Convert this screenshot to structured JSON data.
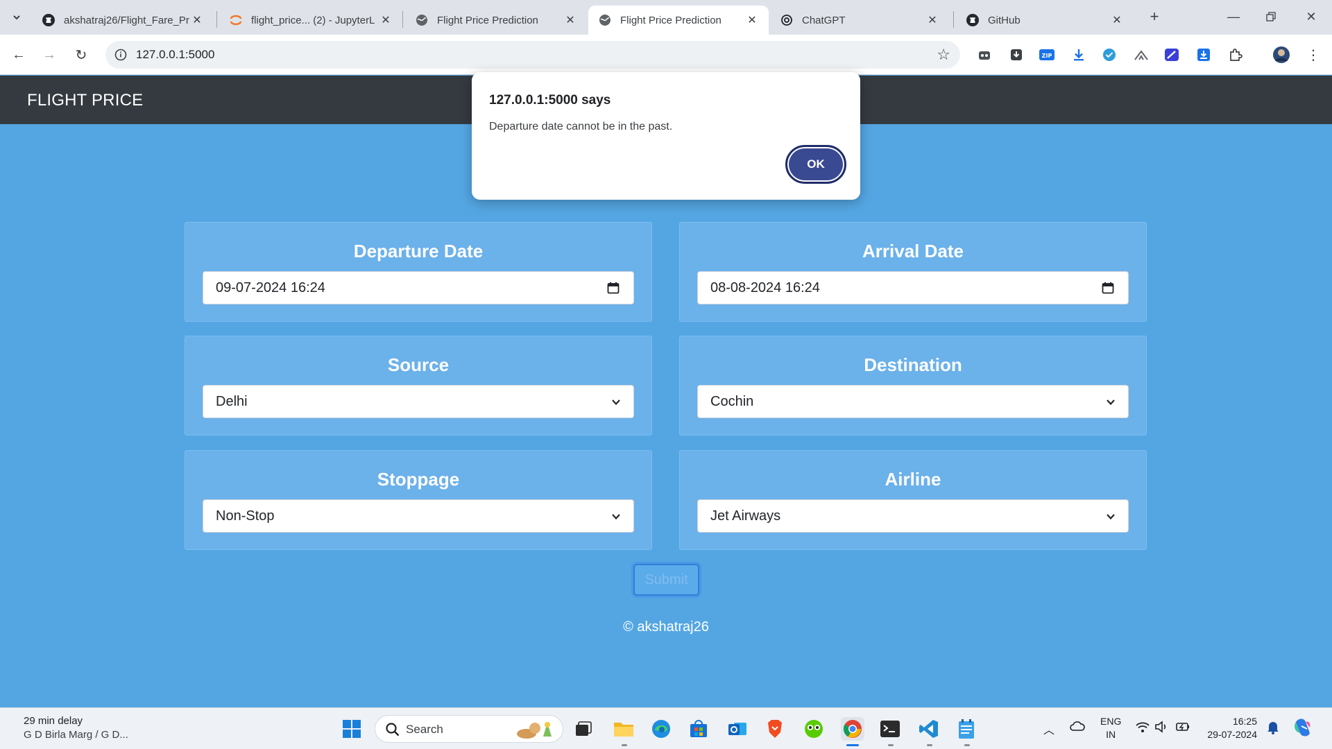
{
  "browser": {
    "tabs": [
      {
        "title": "akshatraj26/Flight_Fare_Pr",
        "icon": "github-icon",
        "active": false
      },
      {
        "title": "flight_price... (2) - JupyterL",
        "icon": "jupyter-icon",
        "active": false
      },
      {
        "title": "Flight Price Prediction",
        "icon": "globe-icon",
        "active": false
      },
      {
        "title": "Flight Price Prediction",
        "icon": "globe-icon",
        "active": true
      },
      {
        "title": "ChatGPT",
        "icon": "chatgpt-icon",
        "active": false
      },
      {
        "title": "GitHub",
        "icon": "github-icon",
        "active": false
      }
    ],
    "url": "127.0.0.1:5000"
  },
  "page": {
    "brand": "FLIGHT PRICE",
    "departure_label": "Departure Date",
    "departure_value": "09-07-2024  16:24",
    "arrival_label": "Arrival Date",
    "arrival_value": "08-08-2024  16:24",
    "source_label": "Source",
    "source_value": "Delhi",
    "destination_label": "Destination",
    "destination_value": "Cochin",
    "stoppage_label": "Stoppage",
    "stoppage_value": "Non-Stop",
    "airline_label": "Airline",
    "airline_value": "Jet Airways",
    "submit_label": "Submit",
    "footer": "© akshatraj26"
  },
  "dialog": {
    "title": "127.0.0.1:5000 says",
    "message": "Departure date cannot be in the past.",
    "ok_label": "OK"
  },
  "taskbar": {
    "weather_line1": "29 min delay",
    "weather_line2": "G D Birla Marg / G D...",
    "search_placeholder": "Search",
    "lang_line1": "ENG",
    "lang_line2": "IN",
    "time": "16:25",
    "date": "29-07-2024"
  },
  "colors": {
    "page_bg": "#54a6e3",
    "navbar_bg": "#343a40",
    "card_bg": "#6bb1ea",
    "dialog_ok": "#3a4a92"
  }
}
